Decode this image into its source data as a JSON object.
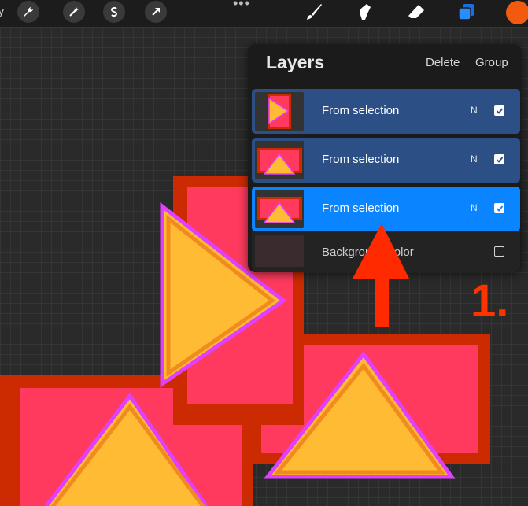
{
  "toolbar": {
    "left_text": "y",
    "left_buttons": [
      "wrench-icon",
      "magic-wand-icon",
      "selection-s-icon",
      "transform-arrow-icon"
    ],
    "more": "•••",
    "tools": [
      "brush-icon",
      "smudge-icon",
      "eraser-icon",
      "layers-icon"
    ],
    "color_swatch": "#f15a0f"
  },
  "layers_panel": {
    "title": "Layers",
    "delete_label": "Delete",
    "group_label": "Group",
    "layers": [
      {
        "name": "From selection",
        "blend": "N",
        "visible": true,
        "state": "selected"
      },
      {
        "name": "From selection",
        "blend": "N",
        "visible": true,
        "state": "selected"
      },
      {
        "name": "From selection",
        "blend": "N",
        "visible": true,
        "state": "active"
      },
      {
        "name": "Background color",
        "blend": "",
        "visible": false,
        "state": "normal"
      }
    ]
  },
  "annotation": {
    "step_label": "1.",
    "color": "#ff3300"
  },
  "colors": {
    "rect_fill": "#ff3a5e",
    "rect_border": "#cc2a00",
    "triangle_fill": "#ffbb33",
    "triangle_stroke": "#e040fb",
    "selected_row": "#2c4f86",
    "active_row": "#0a84ff"
  }
}
